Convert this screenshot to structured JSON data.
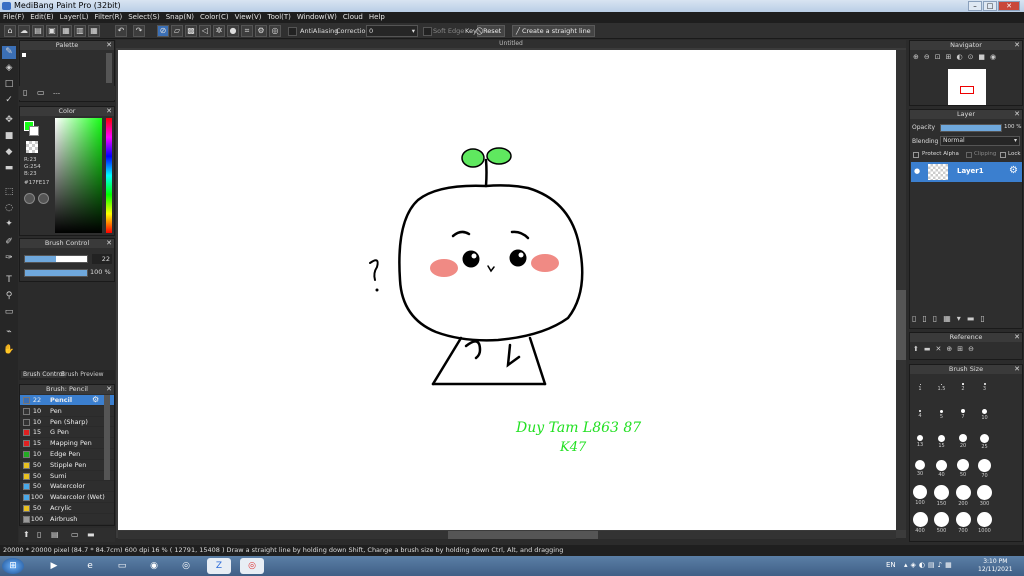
{
  "app": {
    "title": "MediBang Paint Pro (32bit)"
  },
  "menu": [
    "File(F)",
    "Edit(E)",
    "Layer(L)",
    "Filter(R)",
    "Select(S)",
    "Snap(N)",
    "Color(C)",
    "View(V)",
    "Tool(T)",
    "Window(W)",
    "Cloud",
    "Help"
  ],
  "toolbar": {
    "antialias_label": "AntiAliasing",
    "correction_label": "Correction",
    "correction_value": "0",
    "soft_edge_label": "Soft Edge",
    "key_label": "Key",
    "reset_label": "Reset",
    "straight_line_label": "Create a straight line"
  },
  "palette": {
    "title": "Palette",
    "value": "---"
  },
  "color": {
    "title": "Color",
    "r": "R:23",
    "g": "G:254",
    "b": "B:23",
    "hex": "#17FE17",
    "primary": "#17fe17"
  },
  "brush_control": {
    "title": "Brush Control",
    "size": "22",
    "opacity": "100 %",
    "tab1": "Brush Control",
    "tab2": "Brush Preview"
  },
  "brush_list": {
    "title": "Brush: Pencil",
    "items": [
      {
        "size": "22",
        "name": "Pencil",
        "color": "#3b6fb5"
      },
      {
        "size": "10",
        "name": "Pen",
        "color": "#333333"
      },
      {
        "size": "10",
        "name": "Pen (Sharp)",
        "color": "#333333"
      },
      {
        "size": "15",
        "name": "G Pen",
        "color": "#e02020"
      },
      {
        "size": "15",
        "name": "Mapping Pen",
        "color": "#e02020"
      },
      {
        "size": "10",
        "name": "Edge Pen",
        "color": "#22aa22"
      },
      {
        "size": "50",
        "name": "Stipple Pen",
        "color": "#e8c020"
      },
      {
        "size": "50",
        "name": "Sumi",
        "color": "#e8c020"
      },
      {
        "size": "50",
        "name": "Watercolor",
        "color": "#4aa8e8"
      },
      {
        "size": "100",
        "name": "Watercolor (Wet)",
        "color": "#4aa8e8"
      },
      {
        "size": "50",
        "name": "Acrylic",
        "color": "#e8c020"
      },
      {
        "size": "100",
        "name": "Airbrush",
        "color": "#999999"
      }
    ]
  },
  "canvas": {
    "tab": "Untitled",
    "question": "?",
    "handwriting_line1": "Duy Tam L863 87",
    "handwriting_line2": "K47"
  },
  "navigator": {
    "title": "Navigator"
  },
  "layer": {
    "title": "Layer",
    "opacity_label": "Opacity",
    "opacity_value": "100 %",
    "opacity": 1.0,
    "blending_label": "Blending",
    "blending_value": "Normal",
    "protect_alpha": "Protect Alpha",
    "clipping": "Clipping",
    "lock": "Lock",
    "layer_name": "Layer1"
  },
  "reference": {
    "title": "Reference"
  },
  "brush_size": {
    "title": "Brush Size",
    "values": [
      "1",
      "1.5",
      "2",
      "3",
      "4",
      "5",
      "7",
      "10",
      "13",
      "15",
      "20",
      "25",
      "30",
      "40",
      "50",
      "70",
      "100",
      "150",
      "200",
      "300",
      "400",
      "500",
      "700",
      "1000"
    ]
  },
  "status": {
    "text": "20000 * 20000 pixel  (84.7 * 84.7cm)  600 dpi  16 %  ( 12791, 15408 )  Draw a straight line by holding down Shift, Change a brush size by holding down Ctrl, Alt, and dragging"
  },
  "taskbar": {
    "lang": "EN",
    "time": "3:10 PM",
    "date": "12/11/2021"
  }
}
